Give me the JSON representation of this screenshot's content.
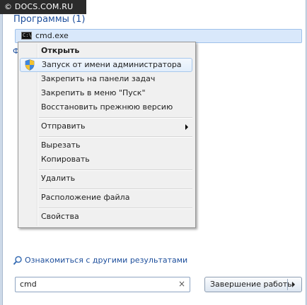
{
  "watermark": "© DOCS.COM.RU",
  "programs": {
    "header": "Программы (1)",
    "items": [
      {
        "label": "cmd.exe",
        "icon": "cmd-icon"
      }
    ]
  },
  "partial_glyph": "Ф",
  "context_menu": {
    "items": [
      {
        "label": "Открыть"
      },
      {
        "label": "Запуск от имени администратора",
        "icon": "uac-shield-icon"
      },
      {
        "label": "Закрепить на панели задач"
      },
      {
        "label": "Закрепить в меню \"Пуск\""
      },
      {
        "label": "Восстановить прежнюю версию"
      },
      {
        "label": "Отправить"
      },
      {
        "label": "Вырезать"
      },
      {
        "label": "Копировать"
      },
      {
        "label": "Удалить"
      },
      {
        "label": "Расположение файла"
      },
      {
        "label": "Свойства"
      }
    ]
  },
  "more_results": "Ознакомиться с другими результатами",
  "search": {
    "value": "cmd",
    "clear": "×"
  },
  "shutdown": {
    "label": "Завершение работы"
  }
}
